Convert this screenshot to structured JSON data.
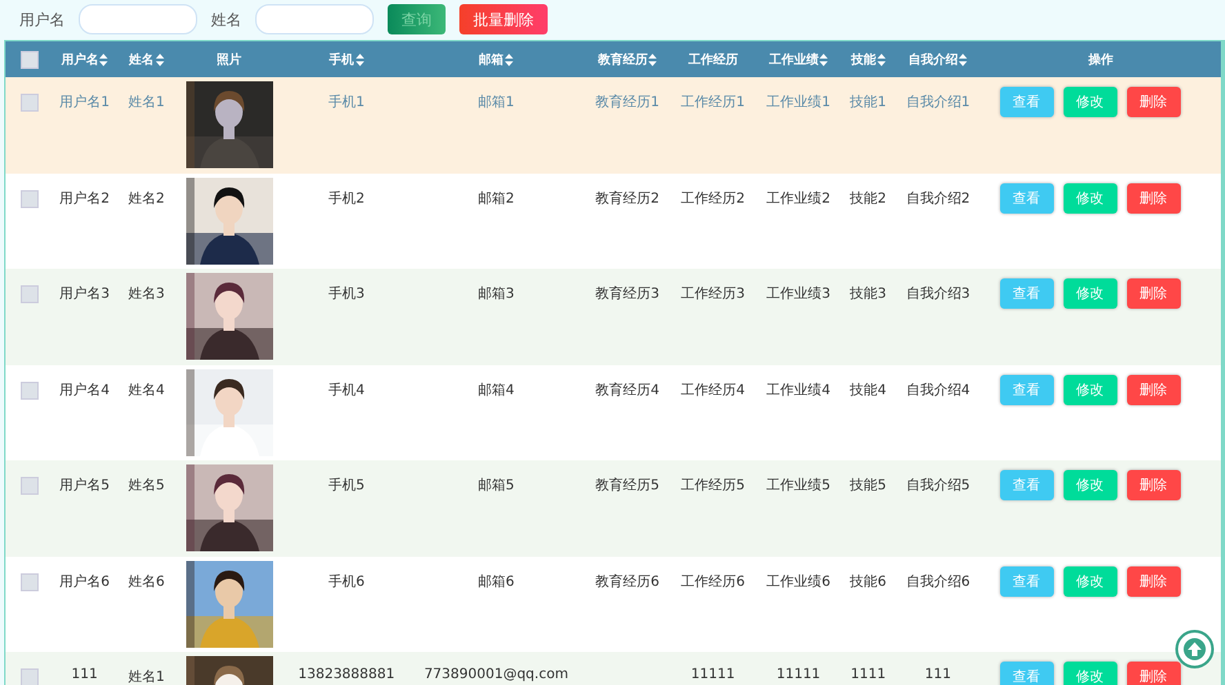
{
  "search": {
    "fields": [
      {
        "label": "用户名"
      },
      {
        "label": "姓名"
      }
    ],
    "buttons": [
      {
        "label": "查询",
        "kind": "search"
      },
      {
        "label": "批量删除",
        "kind": "delete"
      }
    ]
  },
  "table": {
    "all_selected": false,
    "columns": [
      {
        "label": "用户名",
        "sortable": true
      },
      {
        "label": "姓名",
        "sortable": true
      },
      {
        "label": "照片",
        "sortable": false
      },
      {
        "label": "手机",
        "sortable": true
      },
      {
        "label": "邮箱",
        "sortable": true
      },
      {
        "label": "教育经历",
        "sortable": true
      },
      {
        "label": "工作经历",
        "sortable": false
      },
      {
        "label": "工作业绩",
        "sortable": true
      },
      {
        "label": "技能",
        "sortable": true
      },
      {
        "label": "自我介绍",
        "sortable": true
      },
      {
        "label": "操作",
        "sortable": false
      }
    ],
    "rows": [
      {
        "selected": false,
        "hovered": true,
        "cells": [
          "用户名1",
          "姓名1",
          {
            "kind": "picture"
          },
          "手机1",
          "邮箱1",
          "教育经历1",
          "工作经历1",
          "工作业绩1",
          "技能1",
          "自我介绍1"
        ],
        "actions": [
          {
            "label": "查看",
            "kind": "view"
          },
          {
            "label": "修改",
            "kind": "edit"
          },
          {
            "label": "删除",
            "kind": "delete"
          }
        ]
      },
      {
        "selected": false,
        "hovered": false,
        "cells": [
          "用户名2",
          "姓名2",
          {
            "kind": "picture"
          },
          "手机2",
          "邮箱2",
          "教育经历2",
          "工作经历2",
          "工作业绩2",
          "技能2",
          "自我介绍2"
        ],
        "actions": [
          {
            "label": "查看",
            "kind": "view"
          },
          {
            "label": "修改",
            "kind": "edit"
          },
          {
            "label": "删除",
            "kind": "delete"
          }
        ]
      },
      {
        "selected": false,
        "hovered": false,
        "cells": [
          "用户名3",
          "姓名3",
          {
            "kind": "picture"
          },
          "手机3",
          "邮箱3",
          "教育经历3",
          "工作经历3",
          "工作业绩3",
          "技能3",
          "自我介绍3"
        ],
        "actions": [
          {
            "label": "查看",
            "kind": "view"
          },
          {
            "label": "修改",
            "kind": "edit"
          },
          {
            "label": "删除",
            "kind": "delete"
          }
        ]
      },
      {
        "selected": false,
        "hovered": false,
        "cells": [
          "用户名4",
          "姓名4",
          {
            "kind": "picture"
          },
          "手机4",
          "邮箱4",
          "教育经历4",
          "工作经历4",
          "工作业绩4",
          "技能4",
          "自我介绍4"
        ],
        "actions": [
          {
            "label": "查看",
            "kind": "view"
          },
          {
            "label": "修改",
            "kind": "edit"
          },
          {
            "label": "删除",
            "kind": "delete"
          }
        ]
      },
      {
        "selected": false,
        "hovered": false,
        "cells": [
          "用户名5",
          "姓名5",
          {
            "kind": "picture"
          },
          "手机5",
          "邮箱5",
          "教育经历5",
          "工作经历5",
          "工作业绩5",
          "技能5",
          "自我介绍5"
        ],
        "actions": [
          {
            "label": "查看",
            "kind": "view"
          },
          {
            "label": "修改",
            "kind": "edit"
          },
          {
            "label": "删除",
            "kind": "delete"
          }
        ]
      },
      {
        "selected": false,
        "hovered": false,
        "cells": [
          "用户名6",
          "姓名6",
          {
            "kind": "picture"
          },
          "手机6",
          "邮箱6",
          "教育经历6",
          "工作经历6",
          "工作业绩6",
          "技能6",
          "自我介绍6"
        ],
        "actions": [
          {
            "label": "查看",
            "kind": "view"
          },
          {
            "label": "修改",
            "kind": "edit"
          },
          {
            "label": "删除",
            "kind": "delete"
          }
        ]
      },
      {
        "selected": false,
        "hovered": false,
        "cells": [
          "111",
          "姓名1",
          {
            "kind": "picture"
          },
          "13823888881",
          "773890001@qq.com",
          null,
          "11111",
          "11111",
          "1111",
          "111"
        ],
        "actions": [
          {
            "label": "查看",
            "kind": "view"
          },
          {
            "label": "修改",
            "kind": "edit"
          },
          {
            "label": "删除",
            "kind": "delete"
          }
        ]
      }
    ]
  }
}
